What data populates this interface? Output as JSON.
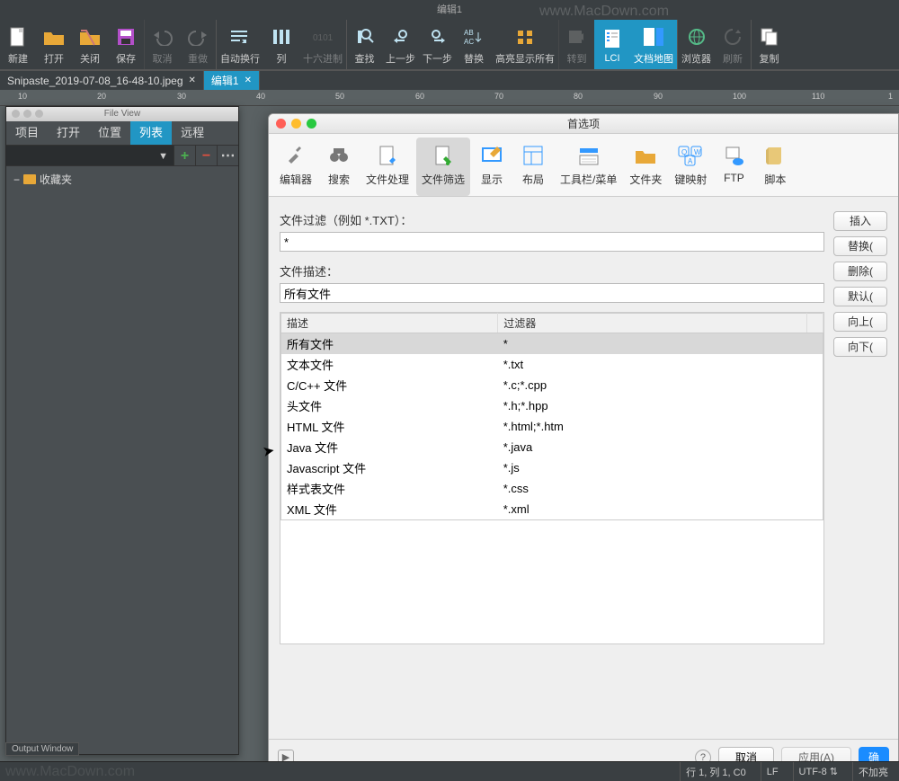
{
  "window_title": "编辑1",
  "main_toolbar": [
    {
      "id": "new",
      "label": "新建",
      "icon": "file-new",
      "active": false,
      "disabled": false
    },
    {
      "id": "open",
      "label": "打开",
      "icon": "folder-open",
      "active": false,
      "disabled": false
    },
    {
      "id": "close",
      "label": "关闭",
      "icon": "folder-close",
      "active": false,
      "disabled": false
    },
    {
      "id": "save",
      "label": "保存",
      "icon": "save",
      "active": false,
      "disabled": false
    },
    {
      "id": "undo",
      "label": "取消",
      "icon": "undo",
      "active": false,
      "disabled": true,
      "sep": true
    },
    {
      "id": "redo",
      "label": "重做",
      "icon": "redo",
      "active": false,
      "disabled": true
    },
    {
      "id": "wrap",
      "label": "自动换行",
      "icon": "wrap",
      "active": false,
      "disabled": false,
      "sep": true
    },
    {
      "id": "col",
      "label": "列",
      "icon": "columns",
      "active": false,
      "disabled": false
    },
    {
      "id": "hex",
      "label": "十六进制",
      "icon": "hex",
      "active": false,
      "disabled": true
    },
    {
      "id": "find",
      "label": "查找",
      "icon": "find",
      "active": false,
      "disabled": false,
      "sep": true
    },
    {
      "id": "prev",
      "label": "上一步",
      "icon": "prev",
      "active": false,
      "disabled": false
    },
    {
      "id": "next",
      "label": "下一步",
      "icon": "next",
      "active": false,
      "disabled": false
    },
    {
      "id": "replace",
      "label": "替换",
      "icon": "replace",
      "active": false,
      "disabled": false
    },
    {
      "id": "hilite",
      "label": "高亮显示所有",
      "icon": "hilite",
      "active": false,
      "disabled": false
    },
    {
      "id": "goto",
      "label": "转到",
      "icon": "goto",
      "active": false,
      "disabled": true,
      "sep": true
    },
    {
      "id": "lci",
      "label": "LCI",
      "icon": "lci",
      "active": true,
      "disabled": false
    },
    {
      "id": "docmap",
      "label": "文档地图",
      "icon": "docmap",
      "active": true,
      "disabled": false
    },
    {
      "id": "browser",
      "label": "浏览器",
      "icon": "browser",
      "active": false,
      "disabled": false,
      "sep": true
    },
    {
      "id": "refresh",
      "label": "刷新",
      "icon": "refresh",
      "active": false,
      "disabled": true
    },
    {
      "id": "copy",
      "label": "复制",
      "icon": "copy",
      "active": false,
      "disabled": false,
      "sep": true
    }
  ],
  "doc_tabs": [
    {
      "label": "Snipaste_2019-07-08_16-48-10.jpeg",
      "active": false
    },
    {
      "label": "编辑1",
      "active": true
    }
  ],
  "ruler_marks": [
    {
      "pos": 20,
      "label": "10"
    },
    {
      "pos": 108,
      "label": "20"
    },
    {
      "pos": 197,
      "label": "30"
    },
    {
      "pos": 285,
      "label": "40"
    },
    {
      "pos": 373,
      "label": "50"
    },
    {
      "pos": 462,
      "label": "60"
    },
    {
      "pos": 550,
      "label": "70"
    },
    {
      "pos": 638,
      "label": "80"
    },
    {
      "pos": 727,
      "label": "90"
    },
    {
      "pos": 815,
      "label": "100"
    },
    {
      "pos": 903,
      "label": "110"
    },
    {
      "pos": 988,
      "label": "1"
    }
  ],
  "file_view": {
    "title": "File View",
    "tabs": [
      "项目",
      "打开",
      "位置",
      "列表",
      "远程"
    ],
    "active_tab": 3,
    "favorites_label": "收藏夹"
  },
  "prefs": {
    "title": "首选项",
    "toolbar": [
      {
        "id": "editor",
        "label": "编辑器",
        "icon": "tools"
      },
      {
        "id": "search",
        "label": "搜索",
        "icon": "binoc"
      },
      {
        "id": "filehandle",
        "label": "文件处理",
        "icon": "filehandle"
      },
      {
        "id": "filefilter",
        "label": "文件筛选",
        "icon": "filefilter",
        "active": true
      },
      {
        "id": "display",
        "label": "显示",
        "icon": "display"
      },
      {
        "id": "layout",
        "label": "布局",
        "icon": "layout"
      },
      {
        "id": "toolbar",
        "label": "工具栏/菜单",
        "icon": "tbmenu"
      },
      {
        "id": "folder",
        "label": "文件夹",
        "icon": "folder"
      },
      {
        "id": "keymap",
        "label": "键映射",
        "icon": "keymap"
      },
      {
        "id": "ftp",
        "label": "FTP",
        "icon": "ftp"
      },
      {
        "id": "script",
        "label": "脚本",
        "icon": "script"
      }
    ],
    "filter_label": "文件过滤（例如 *.TXT）：",
    "filter_value": "*",
    "desc_label": "文件描述：",
    "desc_value": "所有文件",
    "table_headers": {
      "desc": "描述",
      "filter": "过滤器"
    },
    "table_rows": [
      {
        "desc": "所有文件",
        "filter": "*",
        "sel": true
      },
      {
        "desc": "文本文件",
        "filter": "*.txt"
      },
      {
        "desc": "C/C++ 文件",
        "filter": "*.c;*.cpp"
      },
      {
        "desc": "头文件",
        "filter": "*.h;*.hpp"
      },
      {
        "desc": "HTML 文件",
        "filter": "*.html;*.htm"
      },
      {
        "desc": "Java 文件",
        "filter": "*.java"
      },
      {
        "desc": "Javascript 文件",
        "filter": "*.js"
      },
      {
        "desc": "样式表文件",
        "filter": "*.css"
      },
      {
        "desc": "XML 文件",
        "filter": "*.xml"
      }
    ],
    "side_buttons": [
      "插入",
      "替换(",
      "删除(",
      "默认(",
      "向上(",
      "向下("
    ],
    "footer": {
      "cancel": "取消",
      "apply": "应用(A)",
      "ok": "确"
    }
  },
  "output_window": "Output Window",
  "status": {
    "pos": "行 1, 列 1, C0",
    "eol": "LF",
    "enc": "UTF-8",
    "hl": "不加亮"
  },
  "watermark": "www.MacDown.com"
}
